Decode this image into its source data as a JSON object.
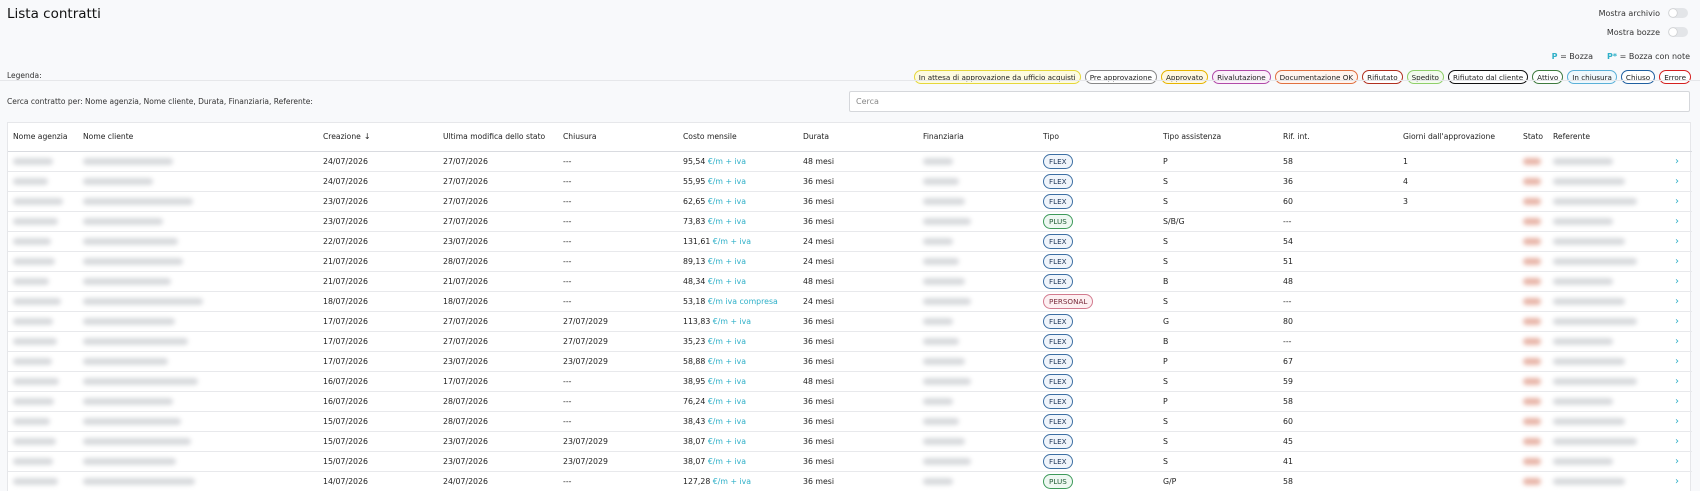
{
  "page": {
    "title": "Lista contratti"
  },
  "toggles": {
    "archive_label": "Mostra archivio",
    "drafts_label": "Mostra bozze"
  },
  "draft_legend": {
    "p_symbol": "P",
    "p_text": "= Bozza",
    "pnote_symbol": "P*",
    "pnote_text": "= Bozza con note"
  },
  "legend": {
    "label": "Legenda:",
    "items": [
      {
        "label": "In attesa di approvazione da ufficio acquisti",
        "border": "#e5d73a",
        "bg": "#fdfbe0"
      },
      {
        "label": "Pre approvazione",
        "border": "#888888",
        "bg": "#ffffff"
      },
      {
        "label": "Approvato",
        "border": "#e6b400",
        "bg": "#fff8e0"
      },
      {
        "label": "Rivalutazione",
        "border": "#b04aa8",
        "bg": "#fbf0fa"
      },
      {
        "label": "Documentazione OK",
        "border": "#e07040",
        "bg": "#fff4ee"
      },
      {
        "label": "Rifiutato",
        "border": "#b03020",
        "bg": "#ffffff"
      },
      {
        "label": "Spedito",
        "border": "#8fcf6a",
        "bg": "#f3fbee"
      },
      {
        "label": "Rifiutato dal cliente",
        "border": "#111111",
        "bg": "#ffffff"
      },
      {
        "label": "Attivo",
        "border": "#3e7a3e",
        "bg": "#ffffff"
      },
      {
        "label": "In chiusura",
        "border": "#5ab0d8",
        "bg": "#eef8fd"
      },
      {
        "label": "Chiuso",
        "border": "#2060a0",
        "bg": "#ffffff"
      },
      {
        "label": "Errore",
        "border": "#d42020",
        "bg": "#ffffff"
      }
    ]
  },
  "search": {
    "label": "Cerca contratto per: Nome agenzia, Nome cliente, Durata, Finanziaria, Referente:",
    "placeholder": "Cerca"
  },
  "table": {
    "headers": [
      "Nome agenzia",
      "Nome cliente",
      "Creazione",
      "Ultima modifica dello stato",
      "Chiusura",
      "Costo mensile",
      "Durata",
      "Finanziaria",
      "Tipo",
      "Tipo assistenza",
      "Rif. int.",
      "Giorni dall'approvazione",
      "Stato",
      "Referente",
      ""
    ],
    "sort_arrow": "↓",
    "rows": [
      {
        "creazione": "24/07/2026",
        "modifica": "27/07/2026",
        "chiusura": "---",
        "costo": "95,54",
        "unit": "€/m + iva",
        "durata": "48 mesi",
        "tipo": "FLEX",
        "assistenza": "P",
        "rif": "58",
        "giorni": "1"
      },
      {
        "creazione": "24/07/2026",
        "modifica": "27/07/2026",
        "chiusura": "---",
        "costo": "55,95",
        "unit": "€/m + iva",
        "durata": "36 mesi",
        "tipo": "FLEX",
        "assistenza": "S",
        "rif": "36",
        "giorni": "4"
      },
      {
        "creazione": "23/07/2026",
        "modifica": "27/07/2026",
        "chiusura": "---",
        "costo": "62,65",
        "unit": "€/m + iva",
        "durata": "36 mesi",
        "tipo": "FLEX",
        "assistenza": "S",
        "rif": "60",
        "giorni": "3"
      },
      {
        "creazione": "23/07/2026",
        "modifica": "27/07/2026",
        "chiusura": "---",
        "costo": "73,83",
        "unit": "€/m + iva",
        "durata": "36 mesi",
        "tipo": "PLUS",
        "assistenza": "S/B/G",
        "rif": "---",
        "giorni": ""
      },
      {
        "creazione": "22/07/2026",
        "modifica": "23/07/2026",
        "chiusura": "---",
        "costo": "131,61",
        "unit": "€/m + iva",
        "durata": "24 mesi",
        "tipo": "FLEX",
        "assistenza": "S",
        "rif": "54",
        "giorni": ""
      },
      {
        "creazione": "21/07/2026",
        "modifica": "28/07/2026",
        "chiusura": "---",
        "costo": "89,13",
        "unit": "€/m + iva",
        "durata": "24 mesi",
        "tipo": "FLEX",
        "assistenza": "S",
        "rif": "51",
        "giorni": ""
      },
      {
        "creazione": "21/07/2026",
        "modifica": "21/07/2026",
        "chiusura": "---",
        "costo": "48,34",
        "unit": "€/m + iva",
        "durata": "48 mesi",
        "tipo": "FLEX",
        "assistenza": "B",
        "rif": "48",
        "giorni": ""
      },
      {
        "creazione": "18/07/2026",
        "modifica": "18/07/2026",
        "chiusura": "---",
        "costo": "53,18",
        "unit": "€/m iva compresa",
        "durata": "24 mesi",
        "tipo": "PERSONAL",
        "assistenza": "S",
        "rif": "---",
        "giorni": ""
      },
      {
        "creazione": "17/07/2026",
        "modifica": "27/07/2026",
        "chiusura": "27/07/2029",
        "costo": "113,83",
        "unit": "€/m + iva",
        "durata": "36 mesi",
        "tipo": "FLEX",
        "assistenza": "G",
        "rif": "80",
        "giorni": ""
      },
      {
        "creazione": "17/07/2026",
        "modifica": "27/07/2026",
        "chiusura": "27/07/2029",
        "costo": "35,23",
        "unit": "€/m + iva",
        "durata": "36 mesi",
        "tipo": "FLEX",
        "assistenza": "B",
        "rif": "---",
        "giorni": ""
      },
      {
        "creazione": "17/07/2026",
        "modifica": "23/07/2026",
        "chiusura": "23/07/2029",
        "costo": "58,88",
        "unit": "€/m + iva",
        "durata": "36 mesi",
        "tipo": "FLEX",
        "assistenza": "P",
        "rif": "67",
        "giorni": ""
      },
      {
        "creazione": "16/07/2026",
        "modifica": "17/07/2026",
        "chiusura": "---",
        "costo": "38,95",
        "unit": "€/m + iva",
        "durata": "48 mesi",
        "tipo": "FLEX",
        "assistenza": "S",
        "rif": "59",
        "giorni": ""
      },
      {
        "creazione": "16/07/2026",
        "modifica": "28/07/2026",
        "chiusura": "---",
        "costo": "76,24",
        "unit": "€/m + iva",
        "durata": "36 mesi",
        "tipo": "FLEX",
        "assistenza": "P",
        "rif": "58",
        "giorni": ""
      },
      {
        "creazione": "15/07/2026",
        "modifica": "28/07/2026",
        "chiusura": "---",
        "costo": "38,43",
        "unit": "€/m + iva",
        "durata": "36 mesi",
        "tipo": "FLEX",
        "assistenza": "S",
        "rif": "60",
        "giorni": ""
      },
      {
        "creazione": "15/07/2026",
        "modifica": "23/07/2026",
        "chiusura": "23/07/2029",
        "costo": "38,07",
        "unit": "€/m + iva",
        "durata": "36 mesi",
        "tipo": "FLEX",
        "assistenza": "S",
        "rif": "45",
        "giorni": ""
      },
      {
        "creazione": "15/07/2026",
        "modifica": "23/07/2026",
        "chiusura": "23/07/2029",
        "costo": "38,07",
        "unit": "€/m + iva",
        "durata": "36 mesi",
        "tipo": "FLEX",
        "assistenza": "S",
        "rif": "41",
        "giorni": ""
      },
      {
        "creazione": "14/07/2026",
        "modifica": "24/07/2026",
        "chiusura": "---",
        "costo": "127,28",
        "unit": "€/m + iva",
        "durata": "36 mesi",
        "tipo": "PLUS",
        "assistenza": "G/P",
        "rif": "58",
        "giorni": ""
      }
    ],
    "row_action_icon": "›"
  }
}
